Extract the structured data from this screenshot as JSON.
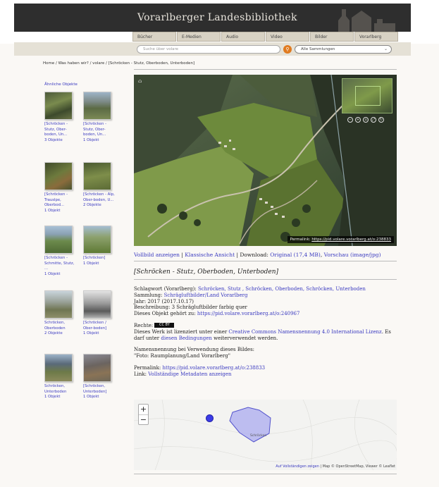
{
  "header": {
    "title": "Vorarlberger Landesbibliothek",
    "tabs": [
      "Bücher",
      "E-Medien",
      "Audio",
      "Video",
      "Bilder",
      "Vorarlberg"
    ]
  },
  "search": {
    "placeholder": "Suche über volare",
    "collections": "Alle Sammlungen"
  },
  "breadcrumb": "Home / Was haben wir? / volare / [Schröcken - Stutz, Oberboden, Unterboden]",
  "sidebar": {
    "title": "Ähnliche Objekte",
    "items": [
      {
        "caption": "[Schröcken - Stutz, Ober-boden, Un...",
        "count": "3 Objekte"
      },
      {
        "caption": "[Schröcken - Stutz, Ober-boden, Un...",
        "count": "1 Objekt"
      },
      {
        "caption": "[Schröcken - Trauslpe, Oberbod...",
        "count": "1 Objekt"
      },
      {
        "caption": "[Schröcken - Alp, Ober-boden, U...",
        "count": "2 Objekte"
      },
      {
        "caption": "[Schröcken - Schmitte, Stutz, ...",
        "count": "1 Objekt"
      },
      {
        "caption": "[Schröcken]",
        "count": "1 Objekt"
      },
      {
        "caption": "Schröcken, Oberboden",
        "count": "2 Objekte"
      },
      {
        "caption": "[Schröcken / Ober-boden]",
        "count": "1 Objekt"
      },
      {
        "caption": "Schröcken, Unterboden",
        "count": "1 Objekt"
      },
      {
        "caption": "[Schröcken, Unterboden]",
        "count": "1 Objekt"
      }
    ]
  },
  "image": {
    "permalink_label": "Permalink:",
    "permalink_url": "https://pid.volare.vorarlberg.at/o:238833"
  },
  "links_row": {
    "vollbild": "Vollbild anzeigen",
    "sep1": " | ",
    "klassisch": "Klassische Ansicht",
    "sep2": " | Download: ",
    "original": "Original (17,4 MB)",
    "sep3": ", ",
    "vorschau": "Vorschau (image/jpg)"
  },
  "object_title": "[Schröcken - Stutz, Oberboden, Unterboden]",
  "meta": {
    "schlagwort_label": "Schlagwort (Vorarlberg): ",
    "schlagwort_values": "Schröcken, Stutz , Schröcken, Oberboden, Schröcken, Unterboden",
    "sammlung_label": "Sammlung: ",
    "sammlung_value": "Schrägluftbilder/Land Vorarlberg",
    "jahr": "Jahr: 2017 (2017.10.17)",
    "beschreibung": "Beschreibung: 3 Schrägluftbilder farbig quer",
    "gehoert_label": "Dieses Objekt gehört zu: ",
    "gehoert_value": "https://pid.volare.vorarlberg.at/o:240967",
    "rechte_label": "Rechte:",
    "cc_badge": "CC BY",
    "license_pre": "Dieses Werk ist lizenziert unter einer ",
    "license_link": "Creative Commons Namensnennung 4.0 International Lizenz",
    "license_mid": ". Es darf unter ",
    "license_link2": "diesen Bedingungen",
    "license_post": " weiterverwendet werden.",
    "nennung_1": "Namensnennung bei Verwendung dieses Bildes:",
    "nennung_2": "\"Foto: Raumplanung/Land Vorarlberg\"",
    "permalink_label": "Permalink: ",
    "permalink_value": "https://pid.volare.vorarlberg.at/o:238833",
    "link_label": "Link: ",
    "link_value": "Vollständige Metadaten anzeigen"
  },
  "map": {
    "zoom_in": "+",
    "zoom_out": "−",
    "place_label": "Schröcken",
    "attribution_link": "Auf Vollständigen zeigen",
    "attribution_text": " | Map © OpenStreetMap, Viewer © Leaflet"
  }
}
